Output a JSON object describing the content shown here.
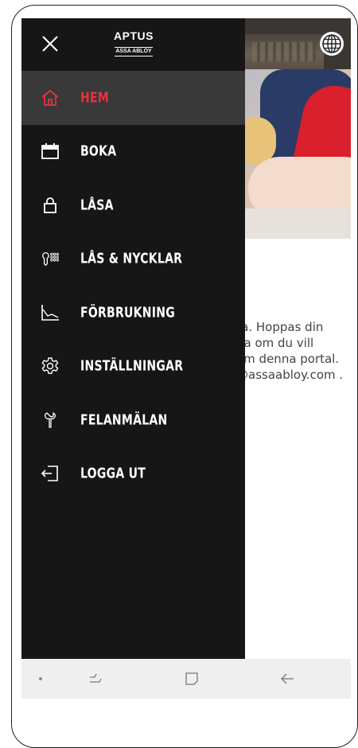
{
  "app": {
    "logo_main": "APTUS",
    "logo_sub": "ASSA ABLOY",
    "accent_color": "#e8323f",
    "drawer_color": "#161616"
  },
  "menu": {
    "items": [
      {
        "label": "HEM",
        "icon": "home-icon",
        "active": true
      },
      {
        "label": "BOKA",
        "icon": "calendar-icon",
        "active": false
      },
      {
        "label": "LÅSA",
        "icon": "lock-icon",
        "active": false
      },
      {
        "label": "LÅS & NYCKLAR",
        "icon": "key-keypad-icon",
        "active": false
      },
      {
        "label": "FÖRBRUKNING",
        "icon": "consumption-chart-icon",
        "active": false
      },
      {
        "label": "INSTÄLLNINGAR",
        "icon": "gear-icon",
        "active": false
      },
      {
        "label": "FELANMÄLAN",
        "icon": "wrench-icon",
        "active": false
      },
      {
        "label": "LOGGA UT",
        "icon": "logout-icon",
        "active": false
      }
    ]
  },
  "background": {
    "text_lines": [
      "ra. Hoppas din",
      "da om du vill",
      "om denna portal.",
      "@assaabloy.com ."
    ]
  }
}
